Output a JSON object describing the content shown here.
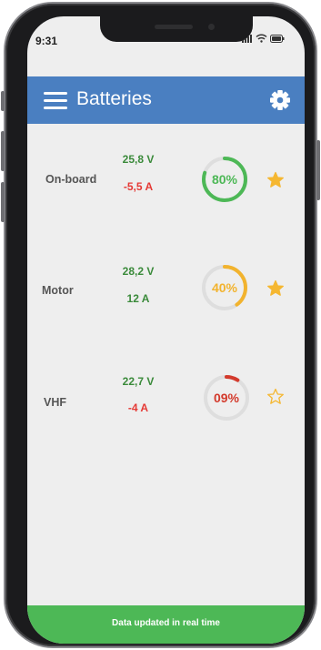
{
  "status_bar": {
    "time": "9:31"
  },
  "app_bar": {
    "title": "Batteries"
  },
  "batteries": [
    {
      "name": "On-board",
      "voltage": "25,8 V",
      "current": "-5,5 A",
      "current_color": "#e53935",
      "percent": "80%",
      "level": 0.8,
      "gauge_color": "#4db856",
      "favorite": true
    },
    {
      "name": "Motor",
      "voltage": "28,2 V",
      "current": "12 A",
      "current_color": "#3a8a3a",
      "percent": "40%",
      "level": 0.4,
      "gauge_color": "#f2b32e",
      "favorite": true
    },
    {
      "name": "VHF",
      "voltage": "22,7 V",
      "current": "-4 A",
      "current_color": "#e53935",
      "percent": "09%",
      "level": 0.09,
      "gauge_color": "#d33a2c",
      "favorite": false
    }
  ],
  "voltage_color": "#3a8a3a",
  "star_color": "#f5b731",
  "footer": {
    "text": "Data updated in real time"
  }
}
